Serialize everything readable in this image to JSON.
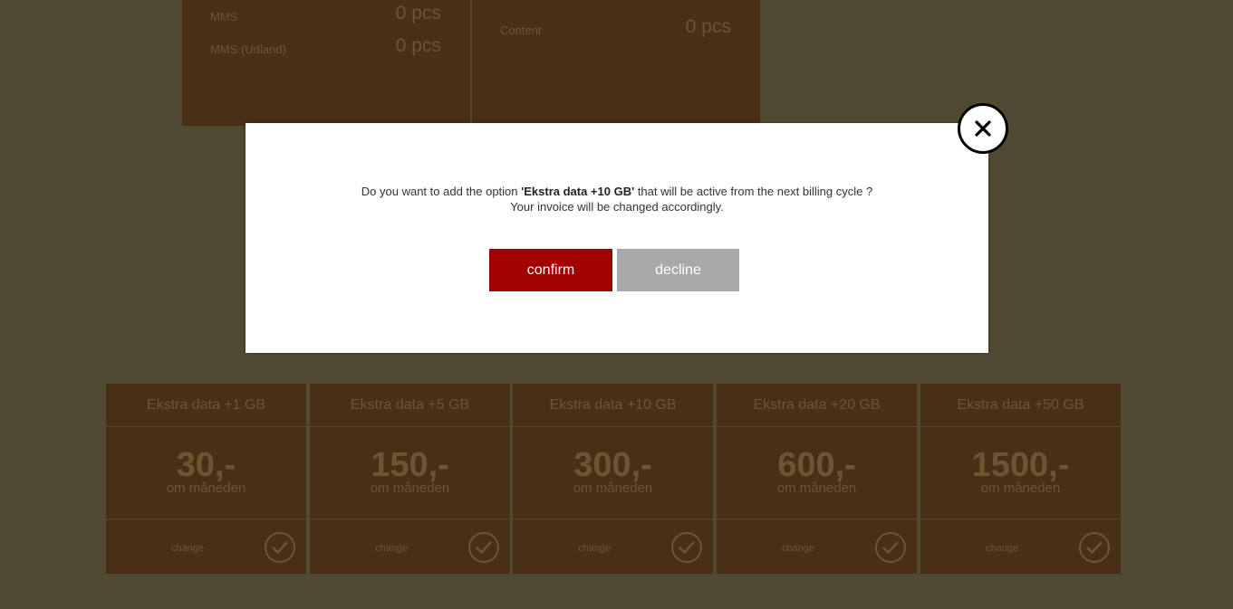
{
  "usage": {
    "left": [
      {
        "label": "MMS",
        "value": "0 pcs"
      },
      {
        "label": "MMS (Udland)",
        "value": "0 pcs"
      }
    ],
    "right": [
      {
        "label": "Content",
        "value": "0 pcs"
      }
    ]
  },
  "options": [
    {
      "title": "Ekstra data +1 GB",
      "price": "30,-",
      "period": "om måneden",
      "action": "change"
    },
    {
      "title": "Ekstra data +5 GB",
      "price": "150,-",
      "period": "om måneden",
      "action": "change"
    },
    {
      "title": "Ekstra data +10 GB",
      "price": "300,-",
      "period": "om måneden",
      "action": "change"
    },
    {
      "title": "Ekstra data +20 GB",
      "price": "600,-",
      "period": "om måneden",
      "action": "change"
    },
    {
      "title": "Ekstra data +50 GB",
      "price": "1500,-",
      "period": "om måneden",
      "action": "change"
    }
  ],
  "modal": {
    "message_before": "Do you want to add the option ",
    "option_name": "'Ekstra data +10 GB'",
    "message_after": " that will be active from the next billing cycle ?",
    "message_line2": "Your invoice will be changed accordingly.",
    "confirm_label": "confirm",
    "decline_label": "decline",
    "close_icon": "close-icon"
  },
  "colors": {
    "confirm": "#a30000",
    "decline": "#a9a9a9",
    "overlay": "#514a33",
    "card": "#4a2f17"
  }
}
